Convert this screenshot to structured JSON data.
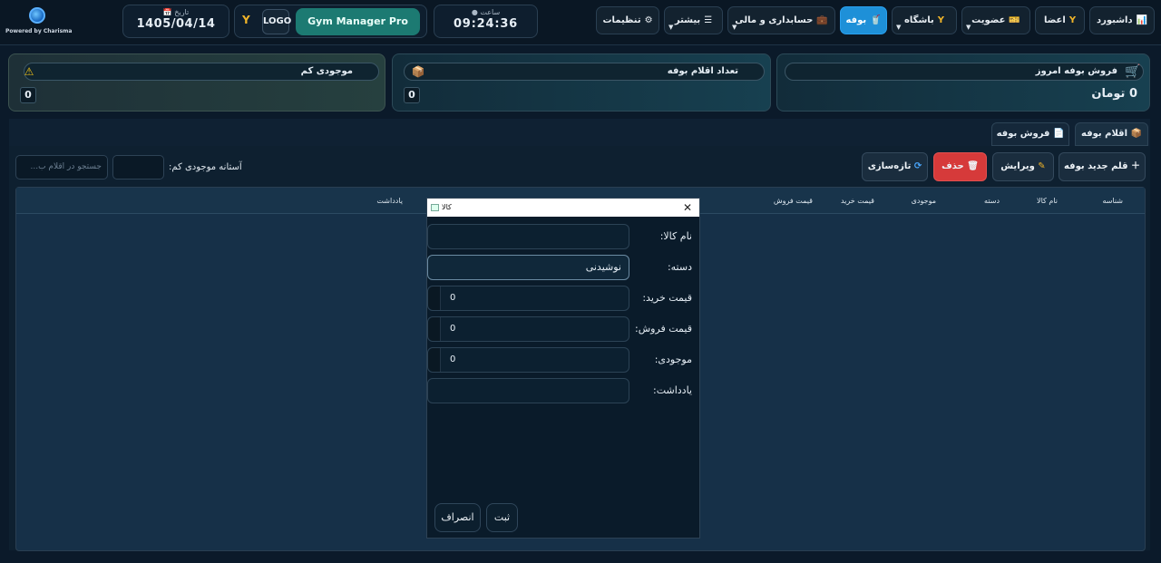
{
  "brand": {
    "powered_by": "Powered by Charisma"
  },
  "header": {
    "date_label": "تاریخ",
    "date_value": "1405/04/14",
    "logo_label": "LOGO",
    "app_name": "Gym Manager Pro",
    "time_label": "ساعت",
    "time_value": "09:24:36"
  },
  "nav": {
    "dashboard": "داشبورد",
    "members": "اعضا",
    "membership": "عضویت",
    "club": "باشگاه",
    "buffet": "بوفه",
    "accounting": "حسابداری و مالی",
    "more": "بیشتر",
    "settings": "تنظیمات"
  },
  "cards": {
    "today_sales": {
      "title": "فروش بوفه امروز",
      "value": "0 تومان"
    },
    "items_count": {
      "title": "تعداد اقلام بوفه",
      "value": "0"
    },
    "low_stock": {
      "title": "موجودی کم",
      "value": "0"
    }
  },
  "tabs": {
    "items": "اقلام بوفه",
    "sales": "فروش بوفه"
  },
  "toolbar": {
    "new_item": "قلم جدید بوفه",
    "edit": "ویرایش",
    "delete": "حذف",
    "refresh": "تازه‌سازی",
    "threshold_label": "آستانه موجودی کم:",
    "search_placeholder": "جستجو در اقلام ب..."
  },
  "table": {
    "columns": [
      "شناسه",
      "نام کالا",
      "دسته",
      "موجودی",
      "قیمت خرید",
      "قیمت فروش",
      "یادداشت"
    ],
    "rows": []
  },
  "dialog": {
    "title": "کالا",
    "name_label": "نام کالا:",
    "name_value": "",
    "category_label": "دسته:",
    "category_value": "نوشیدنی",
    "buy_label": "قیمت خرید:",
    "buy_value": "0",
    "sell_label": "قیمت فروش:",
    "sell_value": "0",
    "stock_label": "موجودی:",
    "stock_value": "0",
    "note_label": "یادداشت:",
    "note_value": "",
    "submit": "ثبت",
    "cancel": "انصراف"
  },
  "colors": {
    "accent": "#1e90d8",
    "brand_teal": "#1c7a72",
    "danger": "#d63a3a",
    "background": "#0b1a2a"
  }
}
